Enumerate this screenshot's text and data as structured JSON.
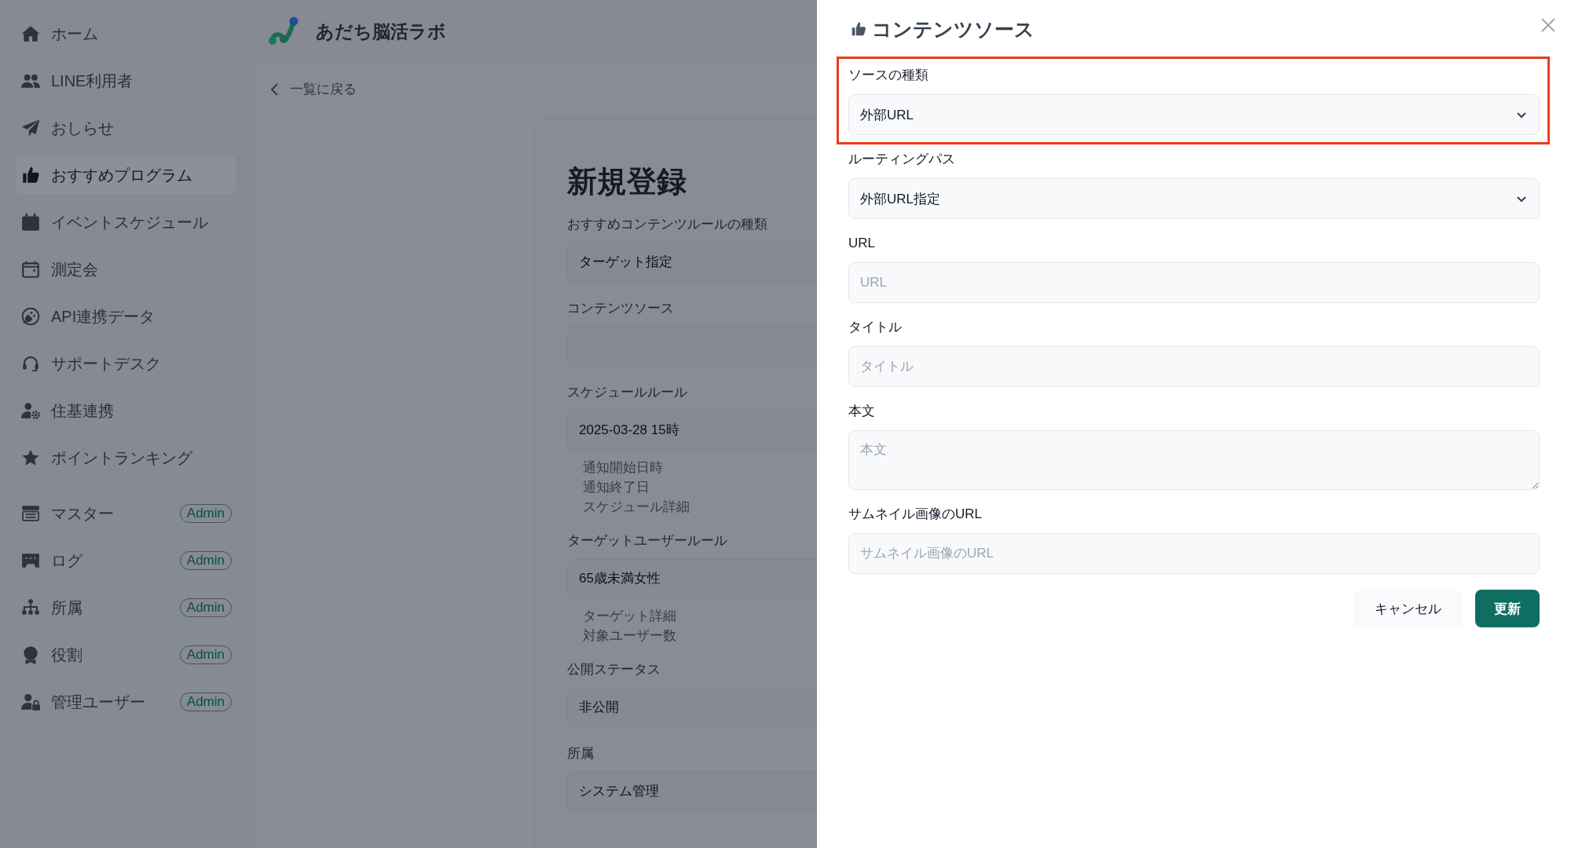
{
  "sidebar": {
    "items": [
      {
        "label": "ホーム",
        "selected": false
      },
      {
        "label": "LINE利用者",
        "selected": false
      },
      {
        "label": "おしらせ",
        "selected": false
      },
      {
        "label": "おすすめプログラム",
        "selected": true
      },
      {
        "label": "イベントスケジュール",
        "selected": false
      },
      {
        "label": "測定会",
        "selected": false
      },
      {
        "label": "API連携データ",
        "selected": false
      },
      {
        "label": "サポートデスク",
        "selected": false
      },
      {
        "label": "住基連携",
        "selected": false
      },
      {
        "label": "ポイントランキング",
        "selected": false
      }
    ],
    "admin_items": [
      {
        "label": "マスター",
        "badge": "Admin",
        "selected": false
      },
      {
        "label": "ログ",
        "badge": "Admin",
        "selected": false
      },
      {
        "label": "所属",
        "badge": "Admin",
        "selected": false
      },
      {
        "label": "役割",
        "badge": "Admin",
        "selected": false
      },
      {
        "label": "管理ユーザー",
        "badge": "Admin",
        "selected": false
      }
    ]
  },
  "header": {
    "app_name": "あだち脳活ラボ"
  },
  "back_link": "一覧に戻る",
  "form": {
    "title": "新規登録",
    "fields": [
      {
        "label": "おすすめコンテンツルールの種類",
        "value": "ターゲット指定"
      },
      {
        "label": "コンテンツソース"
      },
      {
        "label": "スケジュールルール",
        "value": "2025-03-28 15時",
        "details": [
          "通知開始日時",
          "通知終了日",
          "スケジュール詳細"
        ]
      },
      {
        "label": "ターゲットユーザールール",
        "value": "65歳未満女性",
        "details": [
          "ターゲット詳細",
          "対象ユーザー数"
        ]
      },
      {
        "label": "公開ステータス",
        "value": "非公開"
      },
      {
        "label": "所属",
        "value": "システム管理"
      }
    ]
  },
  "drawer": {
    "title": "コンテンツソース",
    "fields": [
      {
        "kind": "select",
        "label": "ソースの種類",
        "value": "外部URL",
        "highlighted": true
      },
      {
        "kind": "select",
        "label": "ルーティングパス",
        "value": "外部URL指定",
        "highlighted": false
      },
      {
        "kind": "text",
        "label": "URL",
        "placeholder": "URL",
        "highlighted": false
      },
      {
        "kind": "text",
        "label": "タイトル",
        "placeholder": "タイトル",
        "highlighted": false
      },
      {
        "kind": "textarea",
        "label": "本文",
        "placeholder": "本文",
        "highlighted": false
      },
      {
        "kind": "text",
        "label": "サムネイル画像のURL",
        "placeholder": "サムネイル画像のURL",
        "highlighted": false
      }
    ],
    "buttons": [
      {
        "kind": "secondary",
        "label": "キャンセル"
      },
      {
        "kind": "primary",
        "label": "更新"
      }
    ]
  }
}
